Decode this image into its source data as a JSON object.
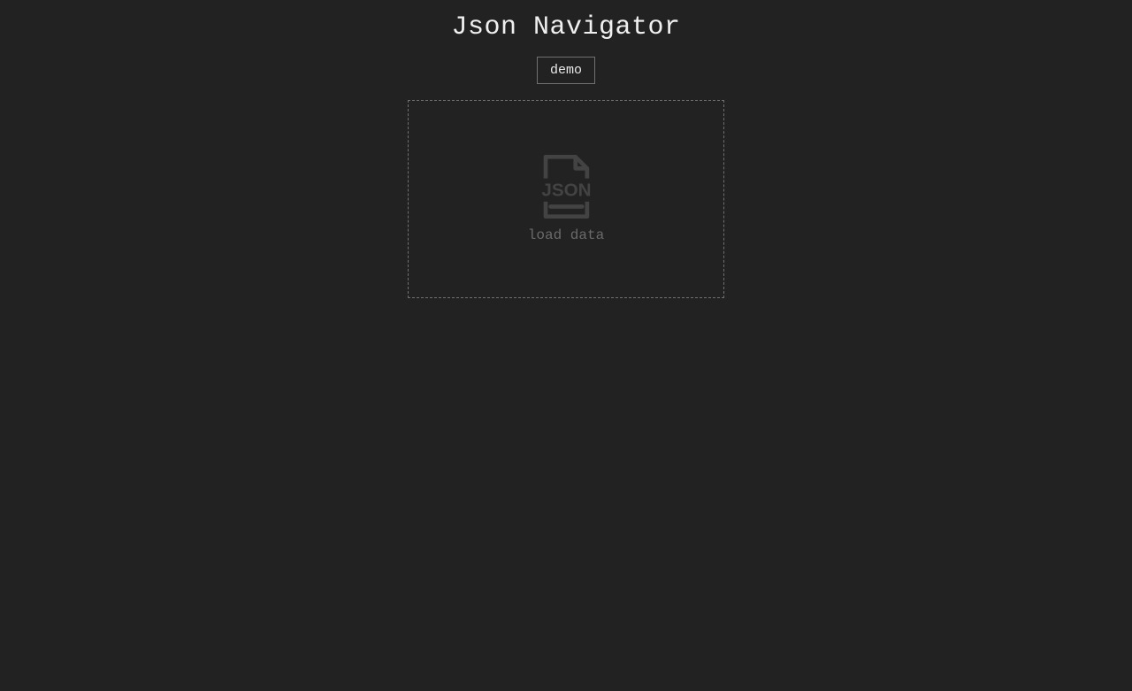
{
  "header": {
    "title": "Json Navigator"
  },
  "toolbar": {
    "demo_label": "demo"
  },
  "dropzone": {
    "icon_text": "JSON",
    "load_label": "load data"
  }
}
